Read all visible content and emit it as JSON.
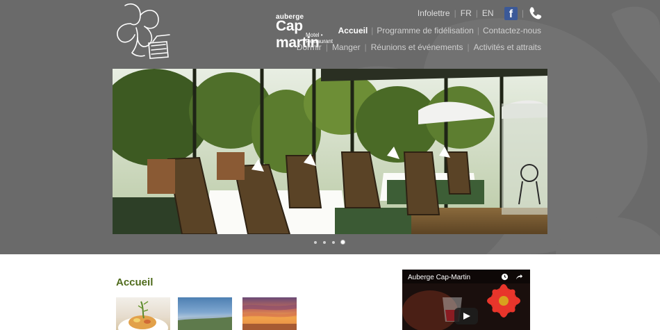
{
  "brand": {
    "small": "auberge",
    "name": "Cap martin",
    "tagline": "Motel • Restaurant"
  },
  "utility_nav": {
    "newsletter": "Infolettre",
    "lang_fr": "FR",
    "lang_en": "EN",
    "facebook_icon": "facebook-icon",
    "phone_icon": "phone-icon"
  },
  "main_nav": {
    "items": [
      "Accueil",
      "Programme de fidélisation",
      "Contactez-nous"
    ],
    "active": "Accueil"
  },
  "sub_nav": {
    "items": [
      "Dormir",
      "Manger",
      "Réunions et événements",
      "Activités et attraits"
    ]
  },
  "slider": {
    "slide_count": 4,
    "active_slide": 4
  },
  "content": {
    "title": "Accueil"
  },
  "video": {
    "title": "Auberge Cap-Martin",
    "icons": [
      "clock-icon",
      "share-icon",
      "play-icon"
    ]
  },
  "colors": {
    "header_bg": "#6a6a6a",
    "title_green": "#4f6b1c",
    "facebook_blue": "#3b5998"
  }
}
